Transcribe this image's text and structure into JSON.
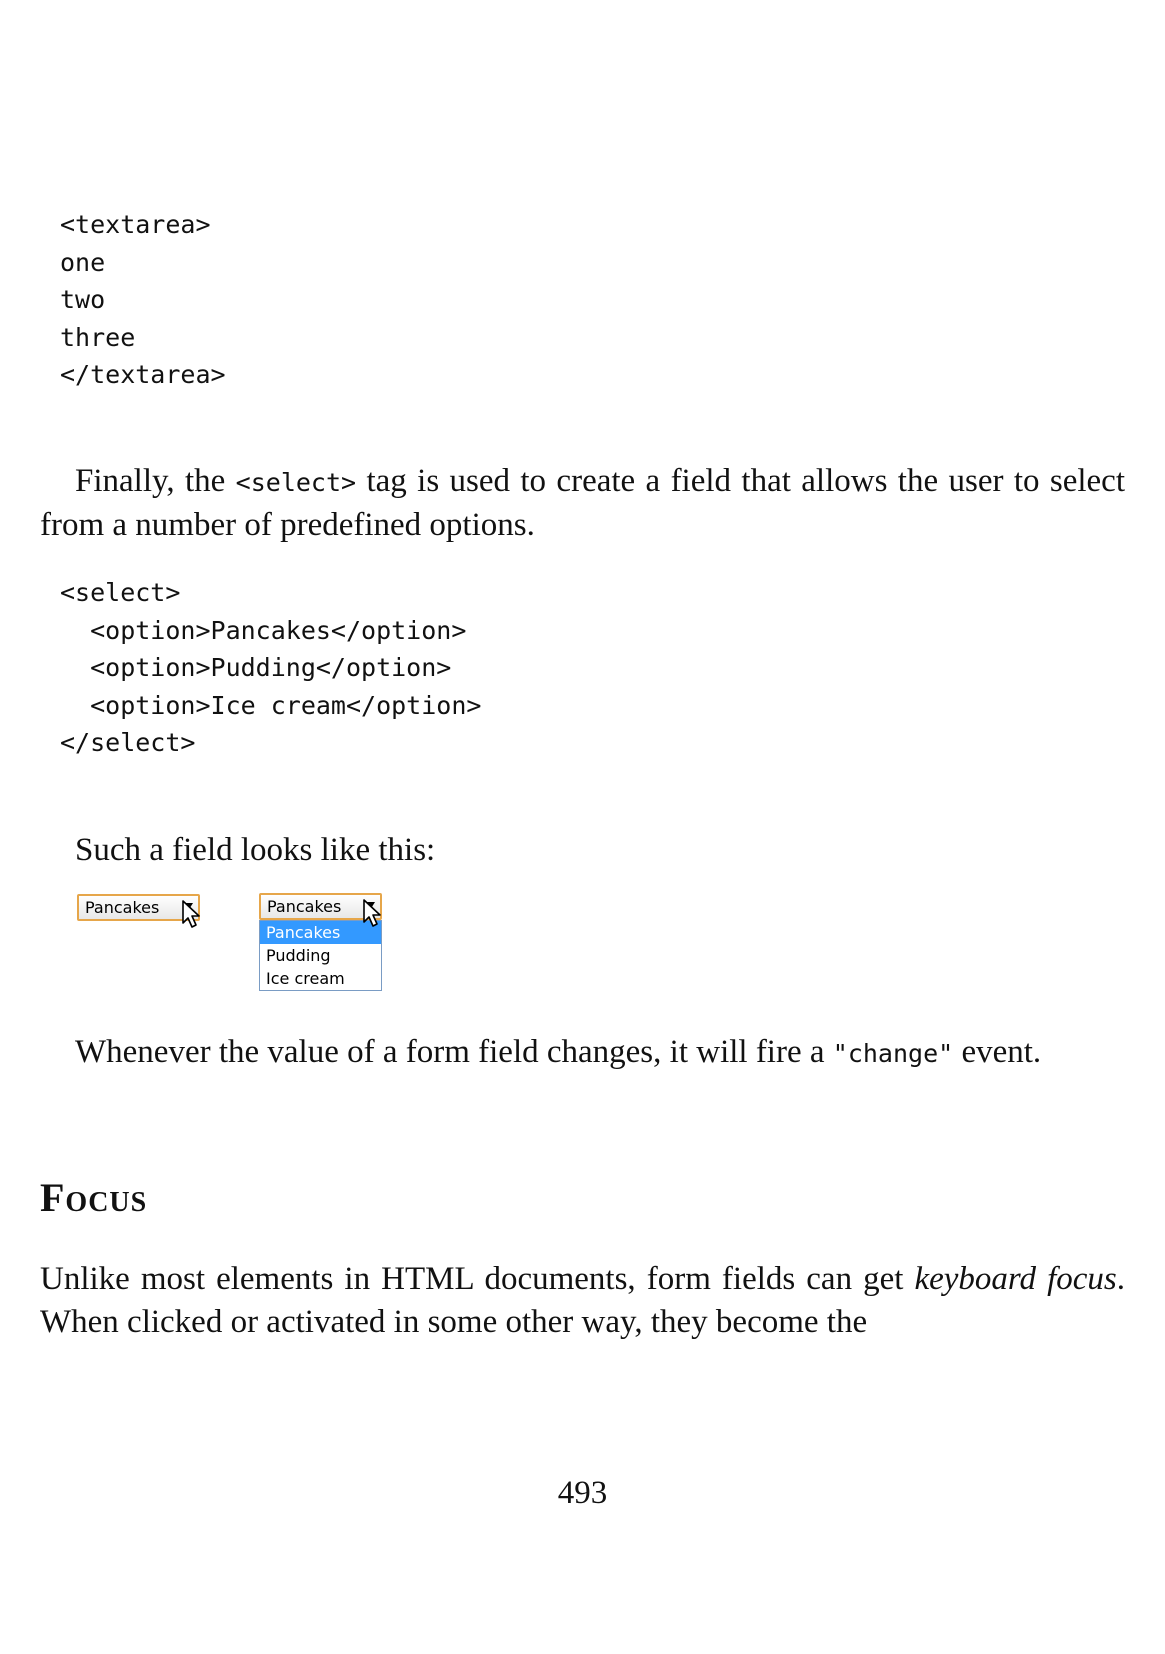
{
  "code_textarea": [
    "<textarea>",
    "one",
    "two",
    "three",
    "</textarea>"
  ],
  "para_select": {
    "before": "Finally, the ",
    "code": "<select>",
    "after": " tag is used to create a field that allows the user to select from a number of predefined options."
  },
  "code_select": [
    "<select>",
    "  <option>Pancakes</option>",
    "  <option>Pudding</option>",
    "  <option>Ice cream</option>",
    "</select>"
  ],
  "para_looks": "Such a field looks like this:",
  "figure": {
    "closed_select_value": "Pancakes",
    "open_select_value": "Pancakes",
    "options": [
      "Pancakes",
      "Pudding",
      "Ice cream"
    ],
    "highlighted_option": "Pancakes",
    "border_color": "#e6a64a",
    "highlight_color": "#3399ff",
    "icons": [
      "dropdown-arrow-icon",
      "mouse-pointer-icon"
    ]
  },
  "para_change": {
    "before": "Whenever the value of a form field changes, it will fire a ",
    "code": "\"change\"",
    "after": " event."
  },
  "section_heading": "Focus",
  "para_focus": {
    "before": "Unlike most elements in HTML documents, form fields can get ",
    "emph": "keyboard focus",
    "after": ". When clicked or activated in some other way, they become the"
  },
  "page_number": "493"
}
